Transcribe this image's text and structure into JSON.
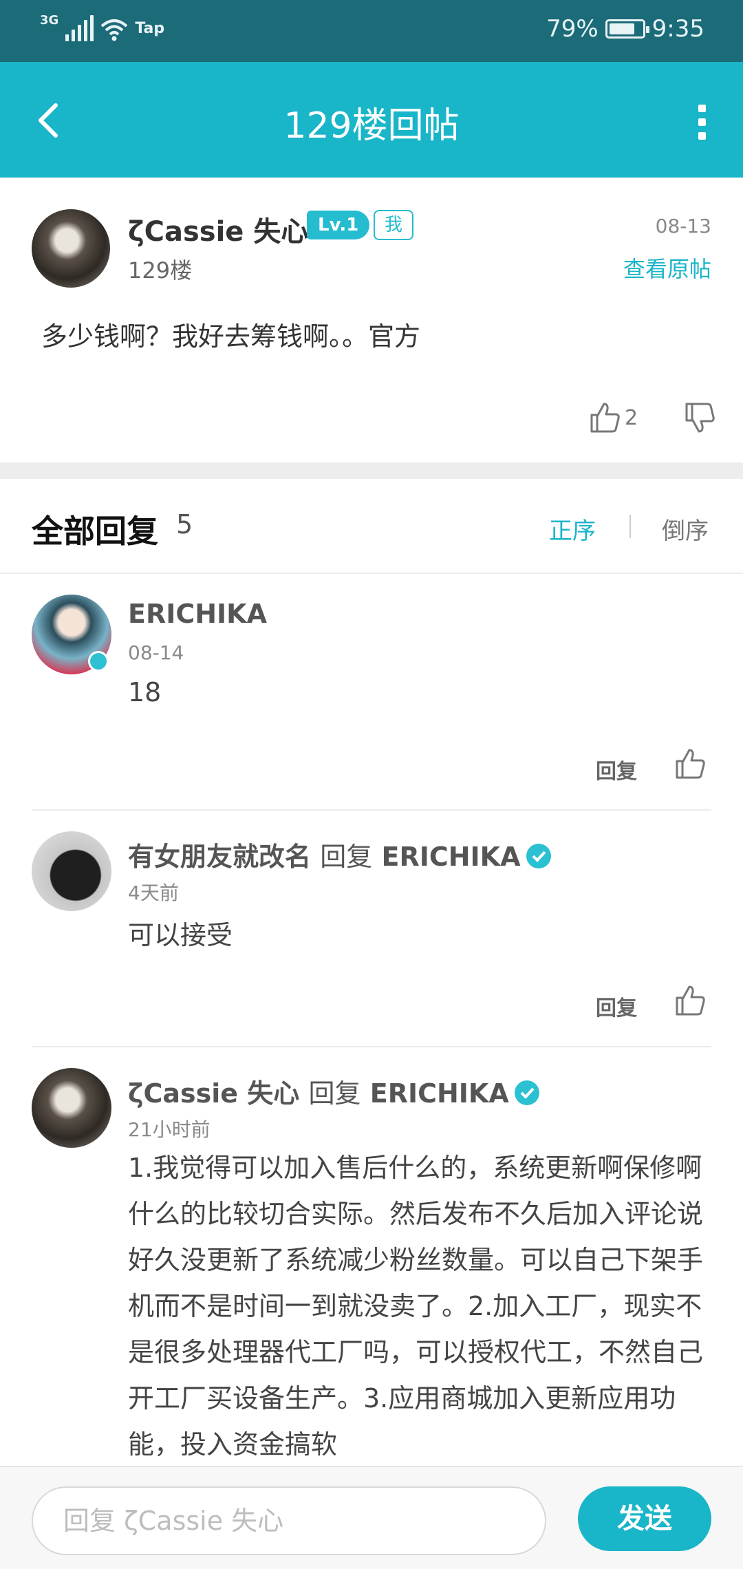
{
  "status_bar": {
    "network": "3G",
    "app_label": "Tap",
    "battery_percent": "79%",
    "battery_level": 0.79,
    "time": "9:35"
  },
  "header": {
    "title": "129楼回帖",
    "back_icon": "chevron-left-icon",
    "more_icon": "more-vertical-icon"
  },
  "post": {
    "author": "ζCassie 失心",
    "level_badge": "Lv.1",
    "me_badge": "我",
    "floor": "129楼",
    "date": "08-13",
    "view_origin_label": "查看原帖",
    "content": "多少钱啊？我好去筹钱啊。。官方",
    "likes": "2"
  },
  "replies_header": {
    "title": "全部回复",
    "count": "5",
    "sort_asc": "正序",
    "sort_desc": "倒序"
  },
  "replies": [
    {
      "author": "ERICHIKA",
      "time": "08-14",
      "content": "18",
      "reply_label": "回复"
    },
    {
      "author": "有女朋友就改名",
      "reply_word": "回复",
      "reply_to": "ERICHIKA",
      "time": "4天前",
      "content": "可以接受",
      "reply_label": "回复"
    },
    {
      "author": "ζCassie 失心",
      "reply_word": "回复",
      "reply_to": "ERICHIKA",
      "time": "21小时前",
      "content": "1.我觉得可以加入售后什么的，系统更新啊保修啊什么的比较切合实际。然后发布不久后加入评论说好久没更新了系统减少粉丝数量。可以自己下架手机而不是时间一到就没卖了。2.加入工厂，现实不是很多处理器代工厂吗，可以授权代工，不然自己开工厂买设备生产。3.应用商城加入更新应用功能，投入资金搞软"
    }
  ],
  "bottom_bar": {
    "input_placeholder": "回复 ζCassie 失心",
    "send_label": "发送"
  },
  "colors": {
    "accent": "#19b5c8",
    "status_bar": "#1b6b78"
  }
}
